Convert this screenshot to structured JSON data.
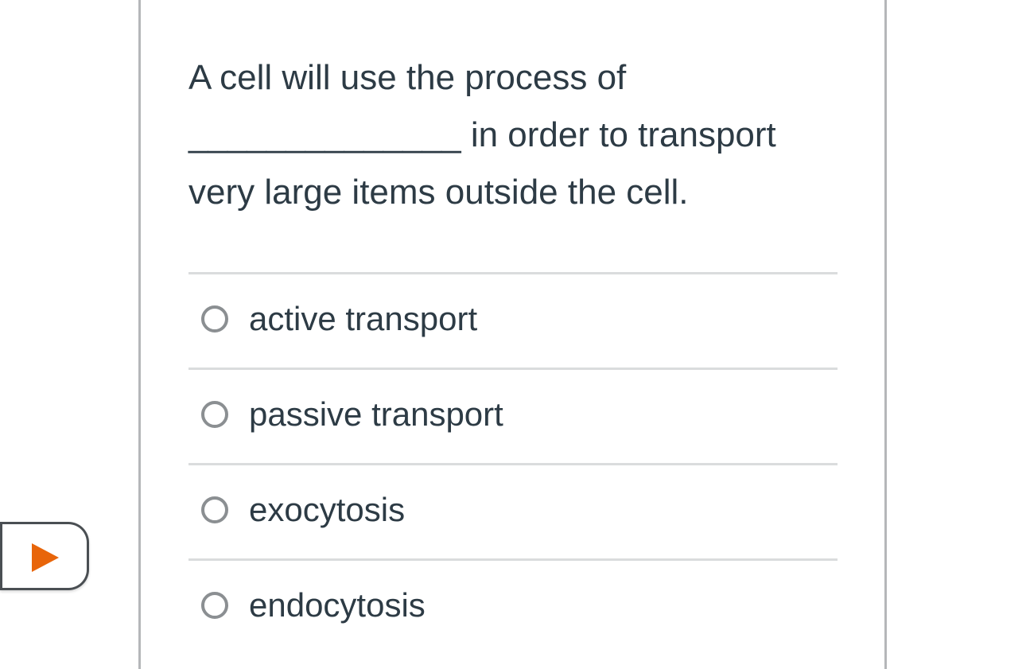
{
  "question": {
    "line1": "A cell will use the process of",
    "line2": "______________ in order to transport",
    "line3": "very large items outside the cell."
  },
  "options": [
    {
      "label": "active transport",
      "selected": false
    },
    {
      "label": "passive transport",
      "selected": false
    },
    {
      "label": "exocytosis",
      "selected": false
    },
    {
      "label": "endocytosis",
      "selected": false
    }
  ],
  "colors": {
    "text": "#2d3b45",
    "divider": "#dadcdd",
    "radio_border": "#8b8f92",
    "rail": "#b5b7b9",
    "play_accent": "#e8650a"
  },
  "icons": {
    "play_tab": "play-icon",
    "option_radio": "radio-circle-icon"
  }
}
